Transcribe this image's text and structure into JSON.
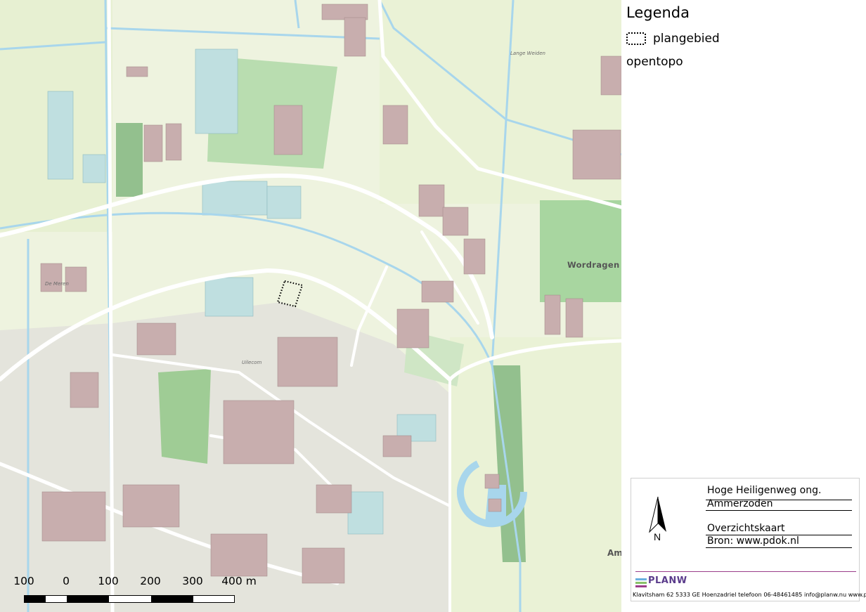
{
  "legend": {
    "title": "Legenda",
    "items": [
      {
        "label": "plangebied",
        "icon": "dotted-boundary-icon"
      }
    ],
    "layer": "opentopo"
  },
  "map": {
    "place_labels": {
      "wordragen": "Wordragen",
      "uilecom": "Uilecom",
      "lange_weiden": "Lange Weiden",
      "de_meren": "De Meren",
      "am": "Am"
    },
    "colors": {
      "meadow": "#eef3df",
      "pasture": "#e6efcf",
      "grass": "#b9ddb0",
      "forest": "#93c08e",
      "water": "#a8d6ec",
      "greenhouse": "#bfdfe0",
      "building": "#c8aeae",
      "road": "#ffffff",
      "urban": "#e2e2dc"
    }
  },
  "scalebar": {
    "labels": [
      "100",
      "0",
      "100",
      "200",
      "300",
      "400 m"
    ]
  },
  "titleblock": {
    "project": "Hoge Heiligenweg ong.",
    "municipality": "Ammerzoden",
    "map_type": "Overzichtskaart",
    "source": "Bron: www.pdok.nl",
    "north_label": "N",
    "logo": "PLANW",
    "contact": "Klavitsham 62 5333 GE Hoenzadriel telefoon 06-48461485 info@planw.nu www.planw.nu"
  }
}
